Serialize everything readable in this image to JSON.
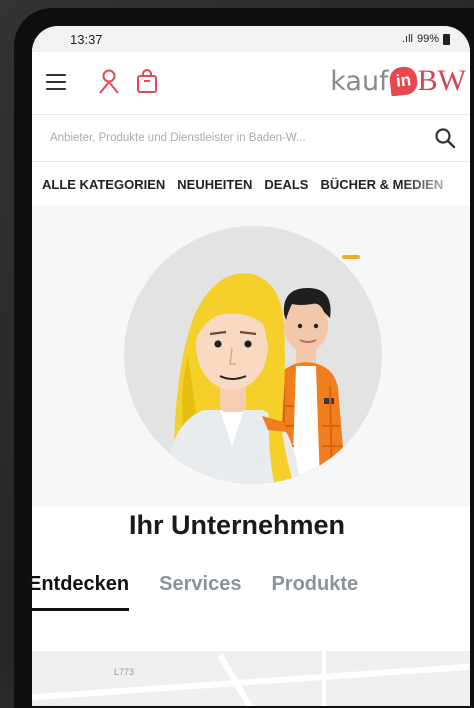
{
  "statusbar": {
    "time": "13:37",
    "signal": ".ıll",
    "battery": "99%"
  },
  "header": {
    "menu_icon": "hamburger-menu-icon",
    "user_icon": "user-icon",
    "bag_icon": "shopping-bag-icon",
    "logo": {
      "part1": "kauf",
      "part2": "in",
      "part3": "BW"
    }
  },
  "search": {
    "placeholder": "Anbieter, Produkte und Dienstleister in Baden-W...",
    "icon": "search-icon"
  },
  "categories": [
    "ALLE KATEGORIEN",
    "NEUHEITEN",
    "DEALS",
    "BÜCHER & MEDIEN"
  ],
  "hero": {
    "title": "Ihr Unternehmen"
  },
  "tabs": [
    {
      "label": "Entdecken",
      "active": true
    },
    {
      "label": "Services",
      "active": false
    },
    {
      "label": "Produkte",
      "active": false
    }
  ],
  "map": {
    "label": "L773"
  },
  "colors": {
    "accent": "#e8474f",
    "background": "#2a2a2a",
    "confetti": "#f3c23a"
  }
}
